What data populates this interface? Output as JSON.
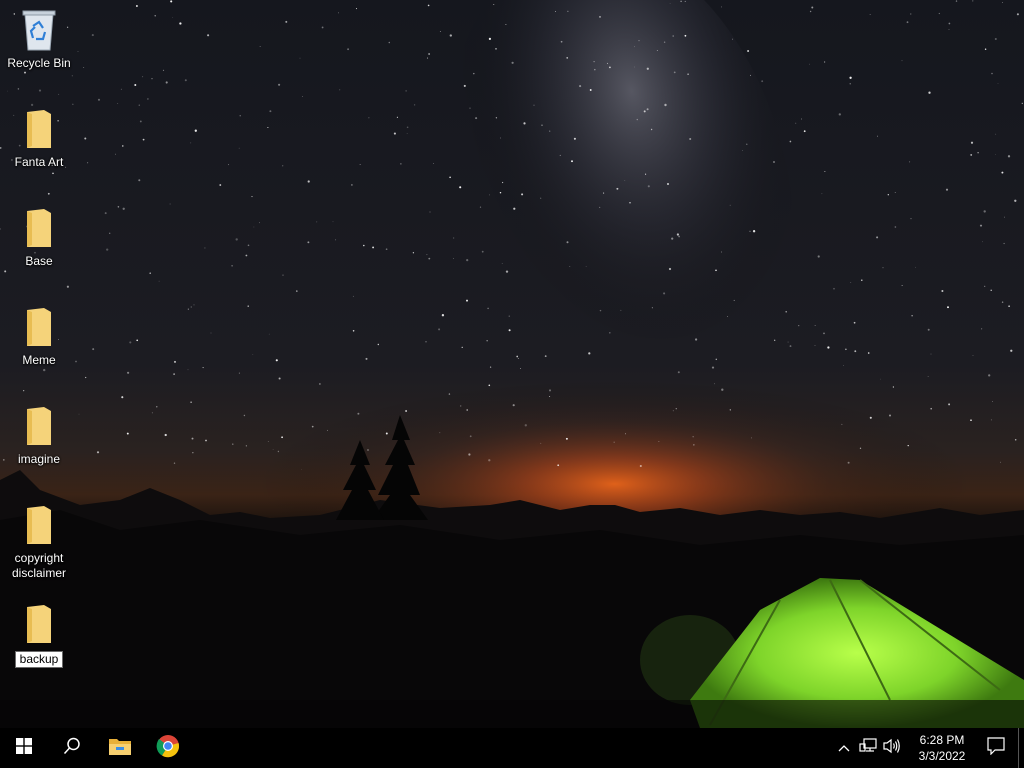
{
  "desktop": {
    "icons": [
      {
        "label": "Recycle Bin",
        "icon": "recycle-bin-icon"
      },
      {
        "label": "Fanta Art",
        "icon": "folder-icon"
      },
      {
        "label": "Base",
        "icon": "folder-icon"
      },
      {
        "label": "Meme",
        "icon": "folder-icon"
      },
      {
        "label": "imagine",
        "icon": "folder-icon"
      },
      {
        "label": "copyright disclaimer",
        "icon": "folder-icon"
      },
      {
        "label": "backup",
        "icon": "folder-icon",
        "renaming": true
      }
    ]
  },
  "taskbar": {
    "start_icon": "windows-logo-icon",
    "search_icon": "search-icon",
    "pinned": [
      {
        "name": "File Explorer",
        "icon": "file-explorer-icon"
      },
      {
        "name": "Google Chrome",
        "icon": "chrome-icon"
      }
    ],
    "tray": {
      "chevron_icon": "chevron-up-icon",
      "network_icon": "network-icon",
      "volume_icon": "volume-icon",
      "time": "6:28 PM",
      "date": "3/3/2022",
      "notification_icon": "action-center-icon"
    }
  },
  "colors": {
    "taskbar": "#000000",
    "folder": "#f5d37a",
    "tent": "#8fe23a"
  }
}
